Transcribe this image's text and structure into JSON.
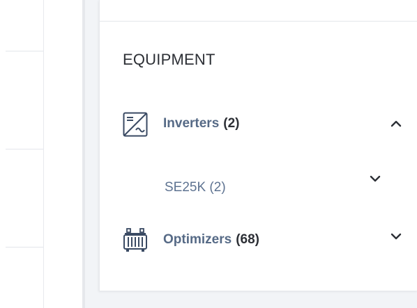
{
  "equipment": {
    "title": "EQUIPMENT",
    "inverters": {
      "label": "Inverters",
      "count": "(2)",
      "icon": "inverter-icon",
      "expanded": true,
      "models": [
        {
          "label": "SE25K (2)"
        }
      ]
    },
    "optimizers": {
      "label": "Optimizers",
      "count": "(68)",
      "icon": "optimizer-icon",
      "expanded": false
    }
  },
  "colors": {
    "label_blue": "#566a86",
    "text_dark": "#2c2f35",
    "background_grey": "#f2f4f7"
  }
}
